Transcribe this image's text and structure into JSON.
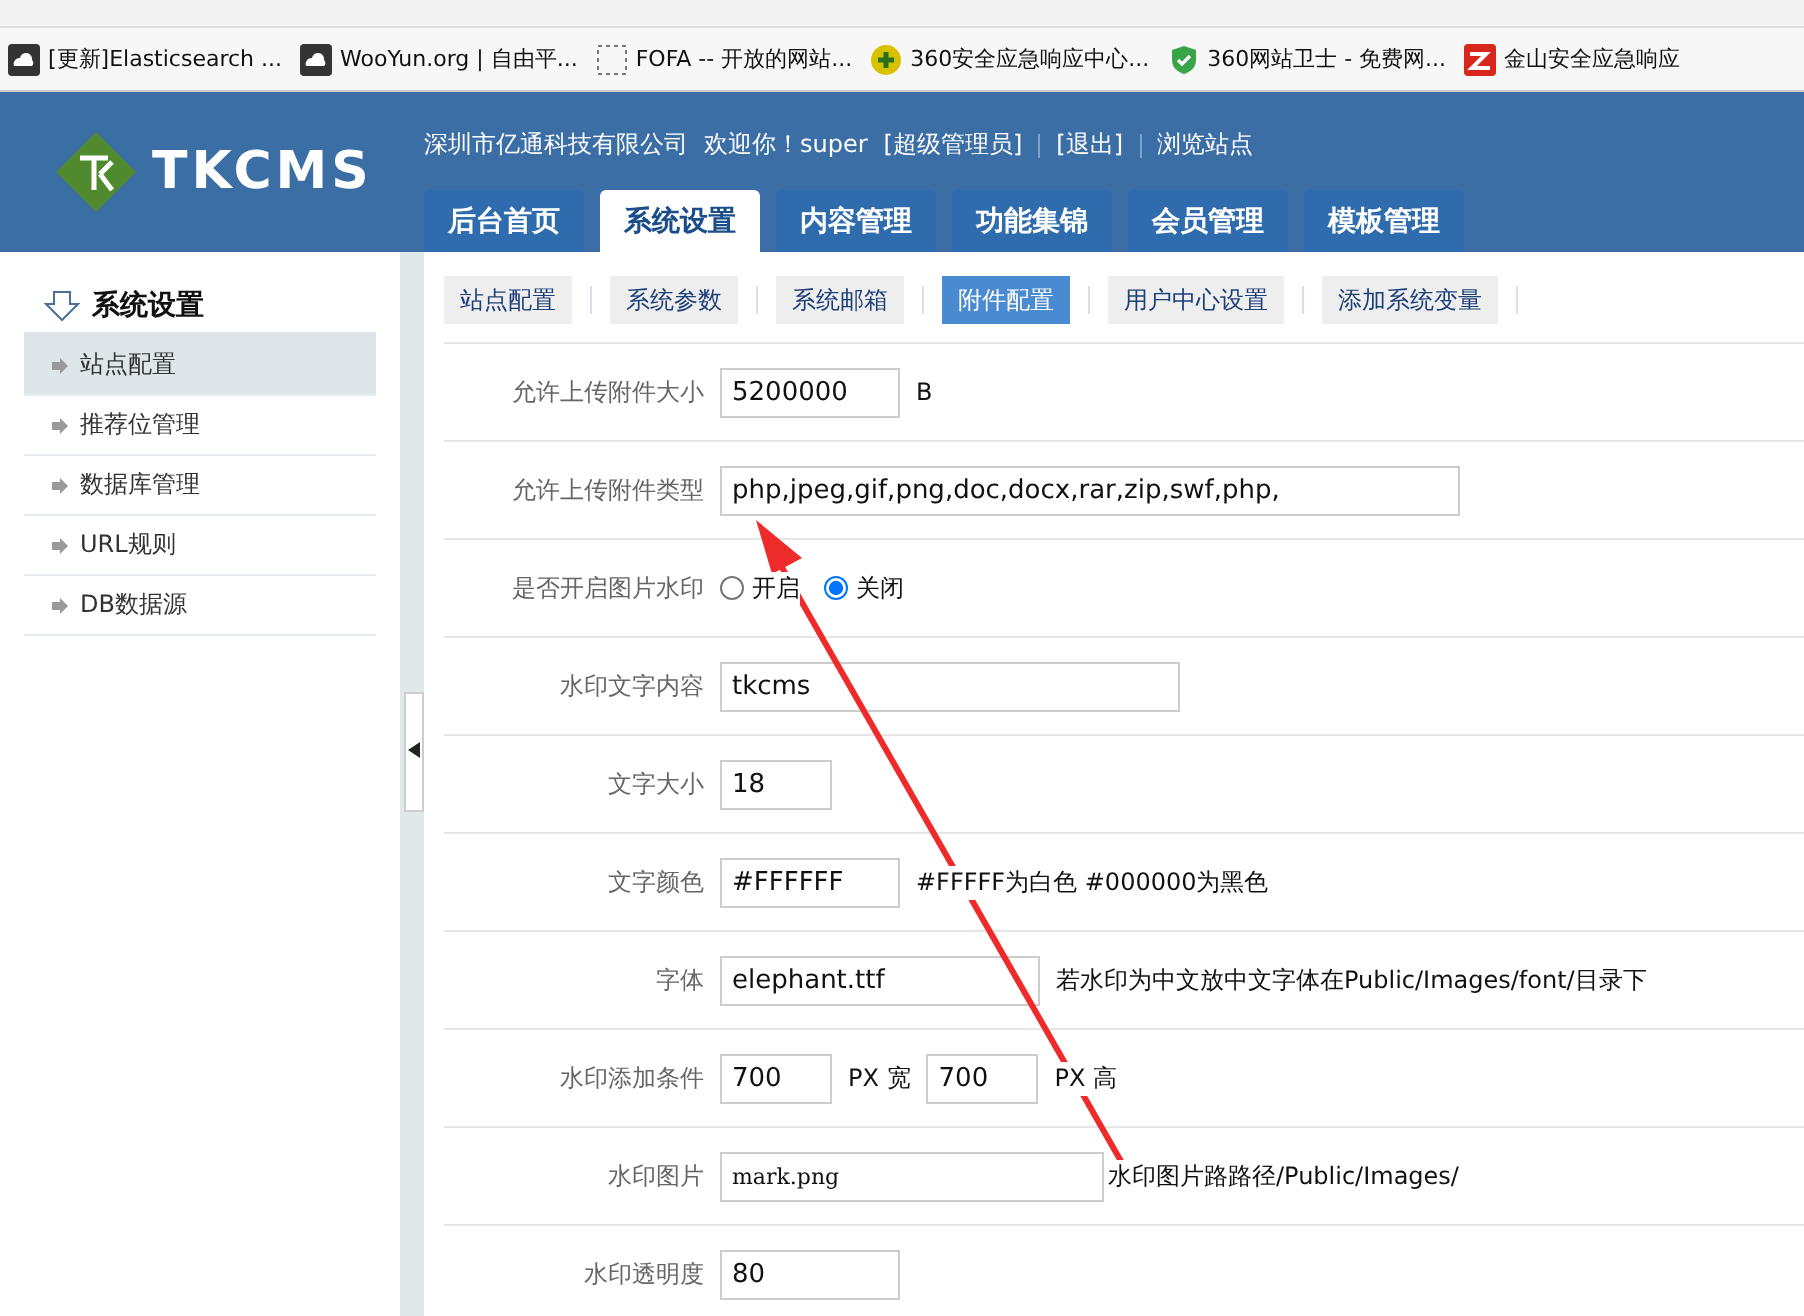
{
  "bookmarks": [
    {
      "label": "[更新]Elasticsearch ..."
    },
    {
      "label": "WooYun.org | 自由平..."
    },
    {
      "label": "FOFA -- 开放的网站..."
    },
    {
      "label": "360安全应急响应中心..."
    },
    {
      "label": "360网站卫士 - 免费网..."
    },
    {
      "label": "金山安全应急响应"
    }
  ],
  "header": {
    "logo": "TKCMS",
    "company": "深圳市亿通科技有限公司",
    "welcome": "欢迎你！super",
    "links": [
      "[超级管理员]",
      "[退出]",
      "浏览站点"
    ],
    "tabs": [
      {
        "label": "后台首页",
        "selected": false
      },
      {
        "label": "系统设置",
        "selected": true
      },
      {
        "label": "内容管理",
        "selected": false
      },
      {
        "label": "功能集锦",
        "selected": false
      },
      {
        "label": "会员管理",
        "selected": false
      },
      {
        "label": "模板管理",
        "selected": false
      }
    ]
  },
  "sidebar": {
    "title": "系统设置",
    "items": [
      {
        "label": "站点配置",
        "selected": true
      },
      {
        "label": "推荐位管理",
        "selected": false
      },
      {
        "label": "数据库管理",
        "selected": false
      },
      {
        "label": "URL规则",
        "selected": false
      },
      {
        "label": "DB数据源",
        "selected": false
      }
    ]
  },
  "subtabs": [
    {
      "label": "站点配置",
      "selected": false
    },
    {
      "label": "系统参数",
      "selected": false
    },
    {
      "label": "系统邮箱",
      "selected": false
    },
    {
      "label": "附件配置",
      "selected": true
    },
    {
      "label": "用户中心设置",
      "selected": false
    },
    {
      "label": "添加系统变量",
      "selected": false
    }
  ],
  "form": [
    {
      "kind": "text",
      "label": "允许上传附件大小",
      "value": "5200000",
      "suffix": "B"
    },
    {
      "kind": "text",
      "label": "允许上传附件类型",
      "value": "php,jpeg,gif,png,doc,docx,rar,zip,swf,php,"
    },
    {
      "kind": "radio",
      "label": "是否开启图片水印",
      "options": [
        {
          "label": "开启",
          "selected": false
        },
        {
          "label": "关闭",
          "selected": true
        }
      ]
    },
    {
      "kind": "text",
      "label": "水印文字内容",
      "value": "tkcms"
    },
    {
      "kind": "text",
      "label": "文字大小",
      "value": "18"
    },
    {
      "kind": "text",
      "label": "文字颜色",
      "value": "#FFFFFF",
      "suffix": "#FFFFF为白色 #000000为黑色"
    },
    {
      "kind": "text",
      "label": "字体",
      "value": "elephant.ttf",
      "suffix": "若水印为中文放中文字体在Public/Images/font/目录下"
    },
    {
      "kind": "pair",
      "label": "水印添加条件",
      "value": "700",
      "unit": "PX 宽",
      "value2": "700",
      "unit2": "PX 高"
    },
    {
      "kind": "mono",
      "label": "水印图片",
      "value": "mark.png",
      "suffix": "水印图片路路径/Public/Images/"
    },
    {
      "kind": "text",
      "label": "水印透明度",
      "value": "80"
    }
  ]
}
